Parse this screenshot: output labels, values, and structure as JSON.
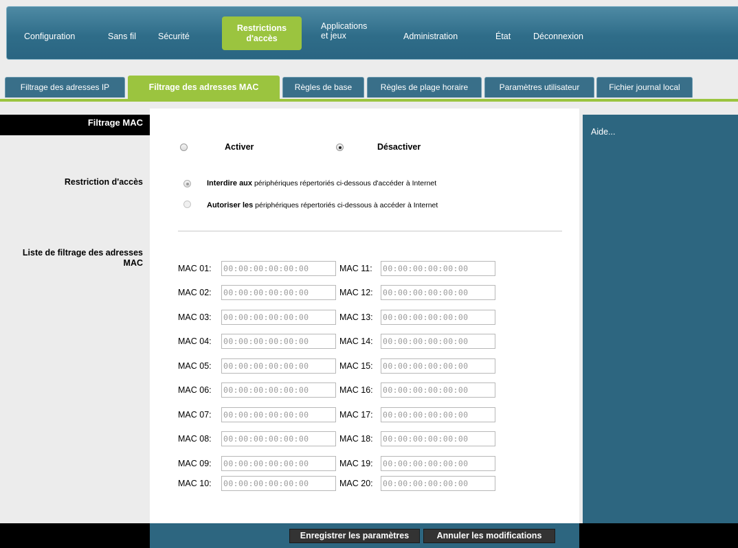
{
  "nav": {
    "items": [
      "Configuration",
      "Sans fil",
      "Sécurité",
      "Applications",
      "et jeux",
      "Administration",
      "État",
      "Déconnexion"
    ],
    "active_line1": "Restrictions",
    "active_line2": "d'accès"
  },
  "tabs": [
    "Filtrage des adresses IP",
    "Filtrage des adresses MAC",
    "Règles de base",
    "Règles de plage horaire",
    "Paramètres utilisateur",
    "Fichier journal local"
  ],
  "left": {
    "header": "Filtrage MAC",
    "restriction_label": "Restriction d'accès",
    "list_label_1": "Liste de filtrage des adresses",
    "list_label_2": "MAC"
  },
  "filter": {
    "enable_label": "Activer",
    "disable_label": "Désactiver",
    "enabled": false,
    "deny_bold": "Interdire aux",
    "deny_rest": " périphériques répertoriés ci-dessous d'accéder à Internet",
    "allow_bold": "Autoriser les",
    "allow_rest": " périphériques répertoriés ci-dessous à accéder à Internet",
    "mode": "deny"
  },
  "mac": {
    "left_labels": [
      "MAC 01:",
      "MAC 02:",
      "MAC 03:",
      "MAC 04:",
      "MAC 05:",
      "MAC 06:",
      "MAC 07:",
      "MAC 08:",
      "MAC 09:",
      "MAC 10:"
    ],
    "right_labels": [
      "MAC 11:",
      "MAC 12:",
      "MAC 13:",
      "MAC 14:",
      "MAC 15:",
      "MAC 16:",
      "MAC 17:",
      "MAC 18:",
      "MAC 19:",
      "MAC 20:"
    ],
    "left_values": [
      "00:00:00:00:00:00",
      "00:00:00:00:00:00",
      "00:00:00:00:00:00",
      "00:00:00:00:00:00",
      "00:00:00:00:00:00",
      "00:00:00:00:00:00",
      "00:00:00:00:00:00",
      "00:00:00:00:00:00",
      "00:00:00:00:00:00",
      "00:00:00:00:00:00"
    ],
    "right_values": [
      "00:00:00:00:00:00",
      "00:00:00:00:00:00",
      "00:00:00:00:00:00",
      "00:00:00:00:00:00",
      "00:00:00:00:00:00",
      "00:00:00:00:00:00",
      "00:00:00:00:00:00",
      "00:00:00:00:00:00",
      "00:00:00:00:00:00",
      "00:00:00:00:00:00"
    ]
  },
  "help": {
    "label": "Aide..."
  },
  "footer": {
    "save_label": "Enregistrer les paramètres",
    "cancel_label": "Annuler les modifications"
  },
  "colors": {
    "accent": "#9bc43f",
    "nav_blue": "#2f6d89",
    "help_blue": "#2d6680",
    "header_black": "#000000"
  }
}
